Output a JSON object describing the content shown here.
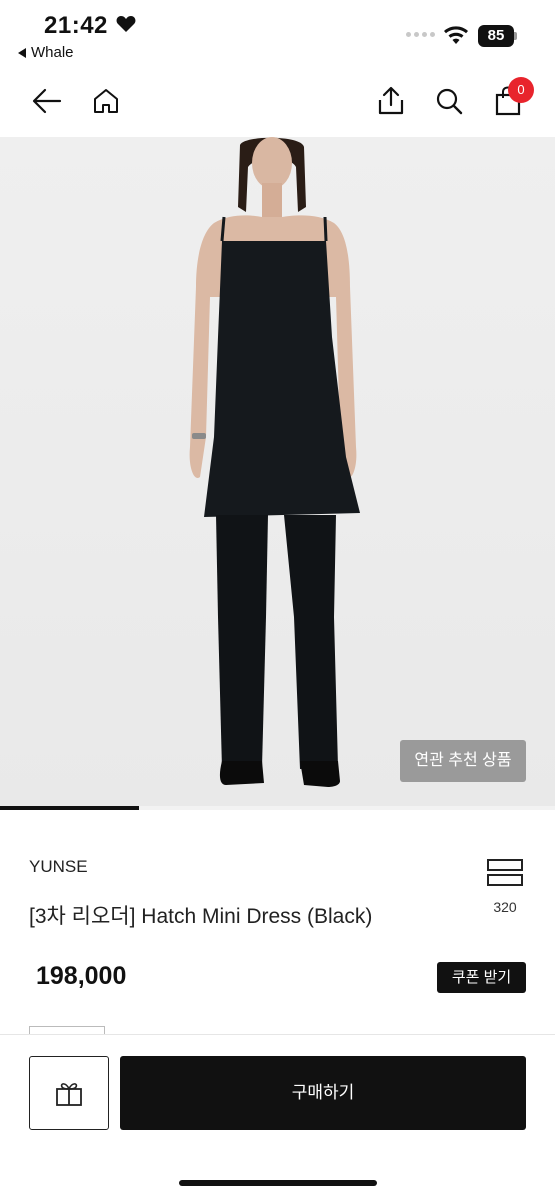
{
  "status_bar": {
    "time": "21:42",
    "back_app": "Whale",
    "battery": "85"
  },
  "nav": {
    "icons": [
      "back-arrow-icon",
      "home-icon",
      "share-icon",
      "search-icon",
      "shopping-bag-icon"
    ],
    "cart_count": "0"
  },
  "hero": {
    "related_button": "연관 추천 상품",
    "slide_progress": 0.25
  },
  "product": {
    "brand": "YUNSE",
    "name": "[3차 리오더] Hatch Mini Dress (Black)",
    "price": "198,000",
    "size_count": "320",
    "coupon_button": "쿠폰 받기"
  },
  "bottom_bar": {
    "buy_button": "구매하기",
    "gift_icon": "gift-icon"
  },
  "colors": {
    "badge": "#e8242c",
    "hero_bg": "#eeeeee",
    "related_btn": "#9a9a9a",
    "primary": "#111111"
  }
}
